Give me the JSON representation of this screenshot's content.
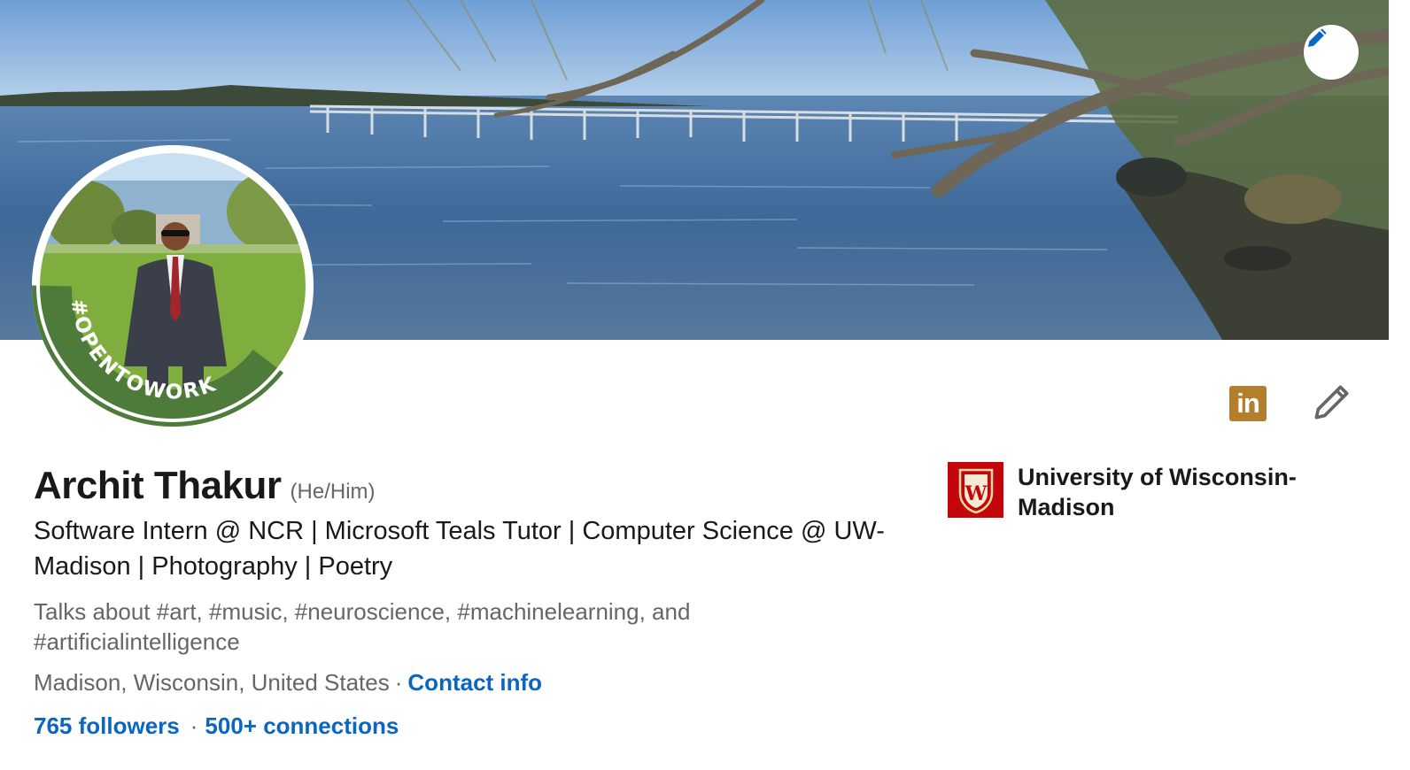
{
  "profile": {
    "name": "Archit Thakur",
    "pronouns": "(He/Him)",
    "headline": "Software Intern @ NCR | Microsoft Teals Tutor | Computer Science @ UW-Madison | Photography | Poetry",
    "talks_about": "Talks about #art, #music, #neuroscience, #machinelearning, and #artificialintelligence",
    "location": "Madison, Wisconsin, United States",
    "location_separator": "·",
    "contact_info_label": "Contact info",
    "followers_label": "765 followers",
    "stats_separator": "·",
    "connections_label": "500+ connections",
    "open_to_work_badge": "#OPENTOWORK"
  },
  "education": {
    "school_name": "University of Wisconsin-Madison",
    "logo_letter": "W"
  },
  "icons": {
    "edit_cover": "pencil-icon",
    "linkedin_badge": "linkedin-icon",
    "linkedin_badge_text": "in",
    "edit_intro": "pencil-outline-icon"
  },
  "colors": {
    "link": "#0a66c2",
    "open_to_work_green": "#4e7a3a",
    "linkedin_badge": "#b37f2e",
    "school_red": "#c5050c"
  }
}
